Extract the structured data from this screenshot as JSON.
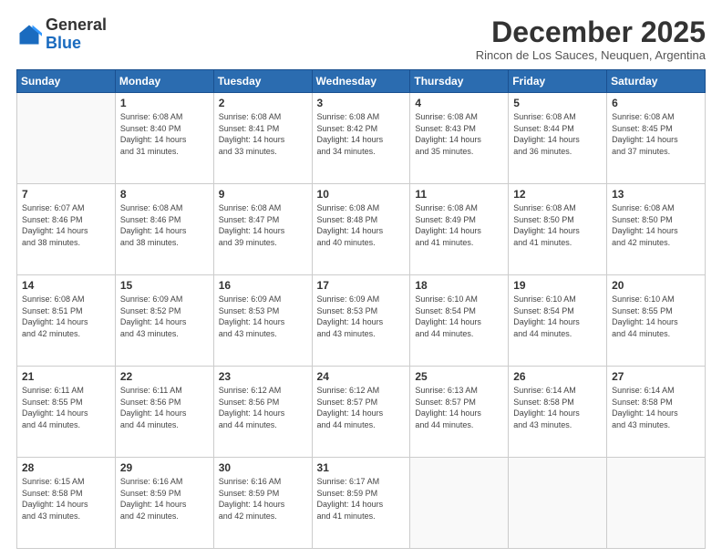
{
  "logo": {
    "general": "General",
    "blue": "Blue"
  },
  "title": "December 2025",
  "subtitle": "Rincon de Los Sauces, Neuquen, Argentina",
  "weekdays": [
    "Sunday",
    "Monday",
    "Tuesday",
    "Wednesday",
    "Thursday",
    "Friday",
    "Saturday"
  ],
  "weeks": [
    [
      {
        "day": "",
        "info": ""
      },
      {
        "day": "1",
        "info": "Sunrise: 6:08 AM\nSunset: 8:40 PM\nDaylight: 14 hours\nand 31 minutes."
      },
      {
        "day": "2",
        "info": "Sunrise: 6:08 AM\nSunset: 8:41 PM\nDaylight: 14 hours\nand 33 minutes."
      },
      {
        "day": "3",
        "info": "Sunrise: 6:08 AM\nSunset: 8:42 PM\nDaylight: 14 hours\nand 34 minutes."
      },
      {
        "day": "4",
        "info": "Sunrise: 6:08 AM\nSunset: 8:43 PM\nDaylight: 14 hours\nand 35 minutes."
      },
      {
        "day": "5",
        "info": "Sunrise: 6:08 AM\nSunset: 8:44 PM\nDaylight: 14 hours\nand 36 minutes."
      },
      {
        "day": "6",
        "info": "Sunrise: 6:08 AM\nSunset: 8:45 PM\nDaylight: 14 hours\nand 37 minutes."
      }
    ],
    [
      {
        "day": "7",
        "info": "Sunrise: 6:07 AM\nSunset: 8:46 PM\nDaylight: 14 hours\nand 38 minutes."
      },
      {
        "day": "8",
        "info": "Sunrise: 6:08 AM\nSunset: 8:46 PM\nDaylight: 14 hours\nand 38 minutes."
      },
      {
        "day": "9",
        "info": "Sunrise: 6:08 AM\nSunset: 8:47 PM\nDaylight: 14 hours\nand 39 minutes."
      },
      {
        "day": "10",
        "info": "Sunrise: 6:08 AM\nSunset: 8:48 PM\nDaylight: 14 hours\nand 40 minutes."
      },
      {
        "day": "11",
        "info": "Sunrise: 6:08 AM\nSunset: 8:49 PM\nDaylight: 14 hours\nand 41 minutes."
      },
      {
        "day": "12",
        "info": "Sunrise: 6:08 AM\nSunset: 8:50 PM\nDaylight: 14 hours\nand 41 minutes."
      },
      {
        "day": "13",
        "info": "Sunrise: 6:08 AM\nSunset: 8:50 PM\nDaylight: 14 hours\nand 42 minutes."
      }
    ],
    [
      {
        "day": "14",
        "info": "Sunrise: 6:08 AM\nSunset: 8:51 PM\nDaylight: 14 hours\nand 42 minutes."
      },
      {
        "day": "15",
        "info": "Sunrise: 6:09 AM\nSunset: 8:52 PM\nDaylight: 14 hours\nand 43 minutes."
      },
      {
        "day": "16",
        "info": "Sunrise: 6:09 AM\nSunset: 8:53 PM\nDaylight: 14 hours\nand 43 minutes."
      },
      {
        "day": "17",
        "info": "Sunrise: 6:09 AM\nSunset: 8:53 PM\nDaylight: 14 hours\nand 43 minutes."
      },
      {
        "day": "18",
        "info": "Sunrise: 6:10 AM\nSunset: 8:54 PM\nDaylight: 14 hours\nand 44 minutes."
      },
      {
        "day": "19",
        "info": "Sunrise: 6:10 AM\nSunset: 8:54 PM\nDaylight: 14 hours\nand 44 minutes."
      },
      {
        "day": "20",
        "info": "Sunrise: 6:10 AM\nSunset: 8:55 PM\nDaylight: 14 hours\nand 44 minutes."
      }
    ],
    [
      {
        "day": "21",
        "info": "Sunrise: 6:11 AM\nSunset: 8:55 PM\nDaylight: 14 hours\nand 44 minutes."
      },
      {
        "day": "22",
        "info": "Sunrise: 6:11 AM\nSunset: 8:56 PM\nDaylight: 14 hours\nand 44 minutes."
      },
      {
        "day": "23",
        "info": "Sunrise: 6:12 AM\nSunset: 8:56 PM\nDaylight: 14 hours\nand 44 minutes."
      },
      {
        "day": "24",
        "info": "Sunrise: 6:12 AM\nSunset: 8:57 PM\nDaylight: 14 hours\nand 44 minutes."
      },
      {
        "day": "25",
        "info": "Sunrise: 6:13 AM\nSunset: 8:57 PM\nDaylight: 14 hours\nand 44 minutes."
      },
      {
        "day": "26",
        "info": "Sunrise: 6:14 AM\nSunset: 8:58 PM\nDaylight: 14 hours\nand 43 minutes."
      },
      {
        "day": "27",
        "info": "Sunrise: 6:14 AM\nSunset: 8:58 PM\nDaylight: 14 hours\nand 43 minutes."
      }
    ],
    [
      {
        "day": "28",
        "info": "Sunrise: 6:15 AM\nSunset: 8:58 PM\nDaylight: 14 hours\nand 43 minutes."
      },
      {
        "day": "29",
        "info": "Sunrise: 6:16 AM\nSunset: 8:59 PM\nDaylight: 14 hours\nand 42 minutes."
      },
      {
        "day": "30",
        "info": "Sunrise: 6:16 AM\nSunset: 8:59 PM\nDaylight: 14 hours\nand 42 minutes."
      },
      {
        "day": "31",
        "info": "Sunrise: 6:17 AM\nSunset: 8:59 PM\nDaylight: 14 hours\nand 41 minutes."
      },
      {
        "day": "",
        "info": ""
      },
      {
        "day": "",
        "info": ""
      },
      {
        "day": "",
        "info": ""
      }
    ]
  ]
}
